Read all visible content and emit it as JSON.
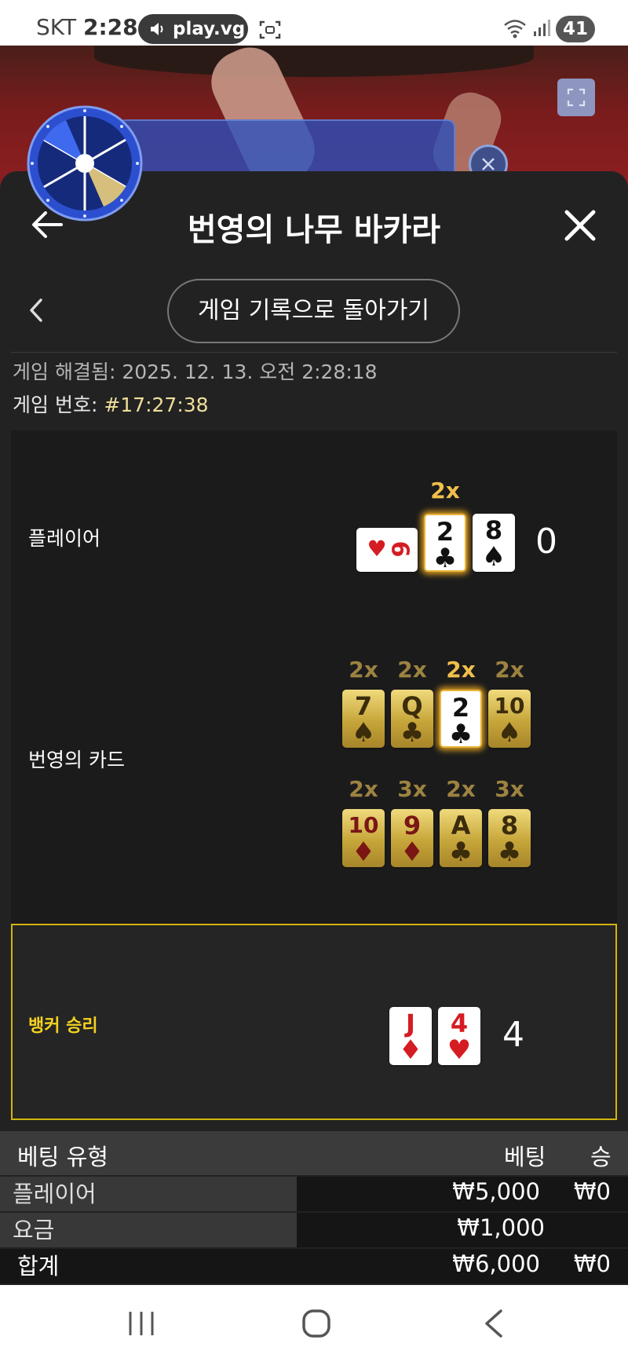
{
  "status_bar": {
    "carrier": "SKT",
    "time": "2:28",
    "url_pill": "play.vg",
    "battery": "41"
  },
  "panel": {
    "title": "번영의 나무 바카라",
    "back_to_history_label": "게임 기록으로 돌아가기",
    "resolved_label": "게임 해결됨:",
    "resolved_value": "2025. 12. 13. 오전 2:28:18",
    "game_no_label": "게임 번호:",
    "game_no_value": "#17:27:38"
  },
  "player": {
    "label": "플레이어",
    "score": "0",
    "multiplier": "2x",
    "cards": [
      {
        "rank": "6",
        "suit": "♥",
        "red": true,
        "sideways": true
      },
      {
        "rank": "2",
        "suit": "♣",
        "red": false,
        "highlight": true
      },
      {
        "rank": "8",
        "suit": "♠",
        "red": false
      }
    ]
  },
  "prosperity": {
    "label": "번영의 카드",
    "row1": [
      {
        "mult": "2x",
        "rank": "7",
        "suit": "♠",
        "red": false
      },
      {
        "mult": "2x",
        "rank": "Q",
        "suit": "♣",
        "red": false
      },
      {
        "mult": "2x",
        "rank": "2",
        "suit": "♣",
        "red": false,
        "highlight": true
      },
      {
        "mult": "2x",
        "rank": "10",
        "suit": "♠",
        "red": false
      }
    ],
    "row2": [
      {
        "mult": "2x",
        "rank": "10",
        "suit": "♦",
        "red": true
      },
      {
        "mult": "3x",
        "rank": "9",
        "suit": "♦",
        "red": true
      },
      {
        "mult": "2x",
        "rank": "A",
        "suit": "♣",
        "red": false
      },
      {
        "mult": "3x",
        "rank": "8",
        "suit": "♣",
        "red": false
      }
    ]
  },
  "banker": {
    "label": "뱅커 승리",
    "score": "4",
    "cards": [
      {
        "rank": "J",
        "suit": "♦",
        "red": true
      },
      {
        "rank": "4",
        "suit": "♥",
        "red": true
      }
    ]
  },
  "bet_table": {
    "headers": {
      "type": "베팅 유형",
      "bet": "베팅",
      "win": "승"
    },
    "rows": [
      {
        "type": "플레이어",
        "bet": "₩5,000",
        "win": "₩0"
      },
      {
        "type": "요금",
        "bet": "₩1,000",
        "win": ""
      }
    ],
    "total": {
      "type": "합계",
      "bet": "₩6,000",
      "win": "₩0"
    }
  },
  "colors": {
    "panel_bg": "#222222",
    "winner_accent": "#f4d21f",
    "multiplier_gold": "#f0c04a",
    "banner_blue": "#2850be"
  }
}
